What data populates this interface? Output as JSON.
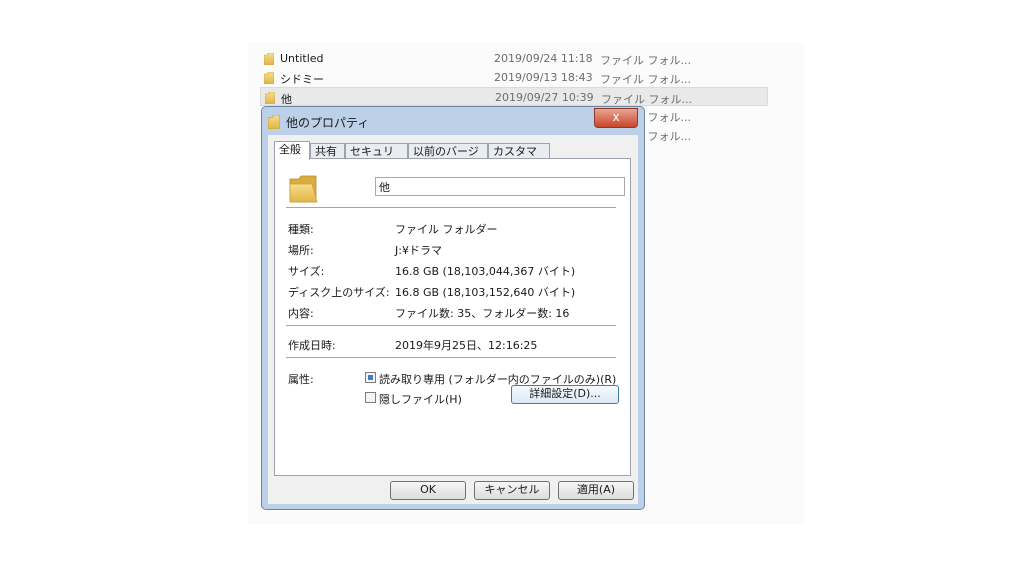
{
  "explorer": {
    "files": [
      {
        "name": "Untitled",
        "date": "2019/09/24 11:18",
        "type": "ファイル フォル..."
      },
      {
        "name": "シドミー",
        "date": "2019/09/13 18:43",
        "type": "ファイル フォル..."
      },
      {
        "name": "他",
        "date": "2019/09/27 10:39",
        "type": "ファイル フォル..."
      },
      {
        "name": "",
        "date": "",
        "type": "ファイル フォル..."
      },
      {
        "name": "",
        "date": "",
        "type": "ファイル フォル..."
      }
    ]
  },
  "dialog": {
    "title": "他のプロパティ",
    "close_glyph": "x",
    "tabs": [
      "全般",
      "共有",
      "セキュリティ",
      "以前のバージョン",
      "カスタマイズ"
    ],
    "folder_name": "他",
    "props": {
      "type_label": "種類:",
      "type_value": "ファイル フォルダー",
      "location_label": "場所:",
      "location_value": "J:¥ドラマ",
      "size_label": "サイズ:",
      "size_value": "16.8 GB (18,103,044,367 バイト)",
      "disk_size_label": "ディスク上のサイズ:",
      "disk_size_value": "16.8 GB (18,103,152,640 バイト)",
      "contents_label": "内容:",
      "contents_value": "ファイル数: 35、フォルダー数: 16",
      "created_label": "作成日時:",
      "created_value": "2019年9月25日、12:16:25",
      "attributes_label": "属性:",
      "readonly_label": "読み取り専用 (フォルダー内のファイルのみ)(R)",
      "hidden_label": "隠しファイル(H)",
      "advanced_button": "詳細設定(D)..."
    },
    "buttons": {
      "ok": "OK",
      "cancel": "キャンセル",
      "apply": "適用(A)"
    }
  },
  "colors": {
    "folder": "#e8c25a",
    "frame": "#bcd0e8",
    "close": "#c8452c"
  }
}
